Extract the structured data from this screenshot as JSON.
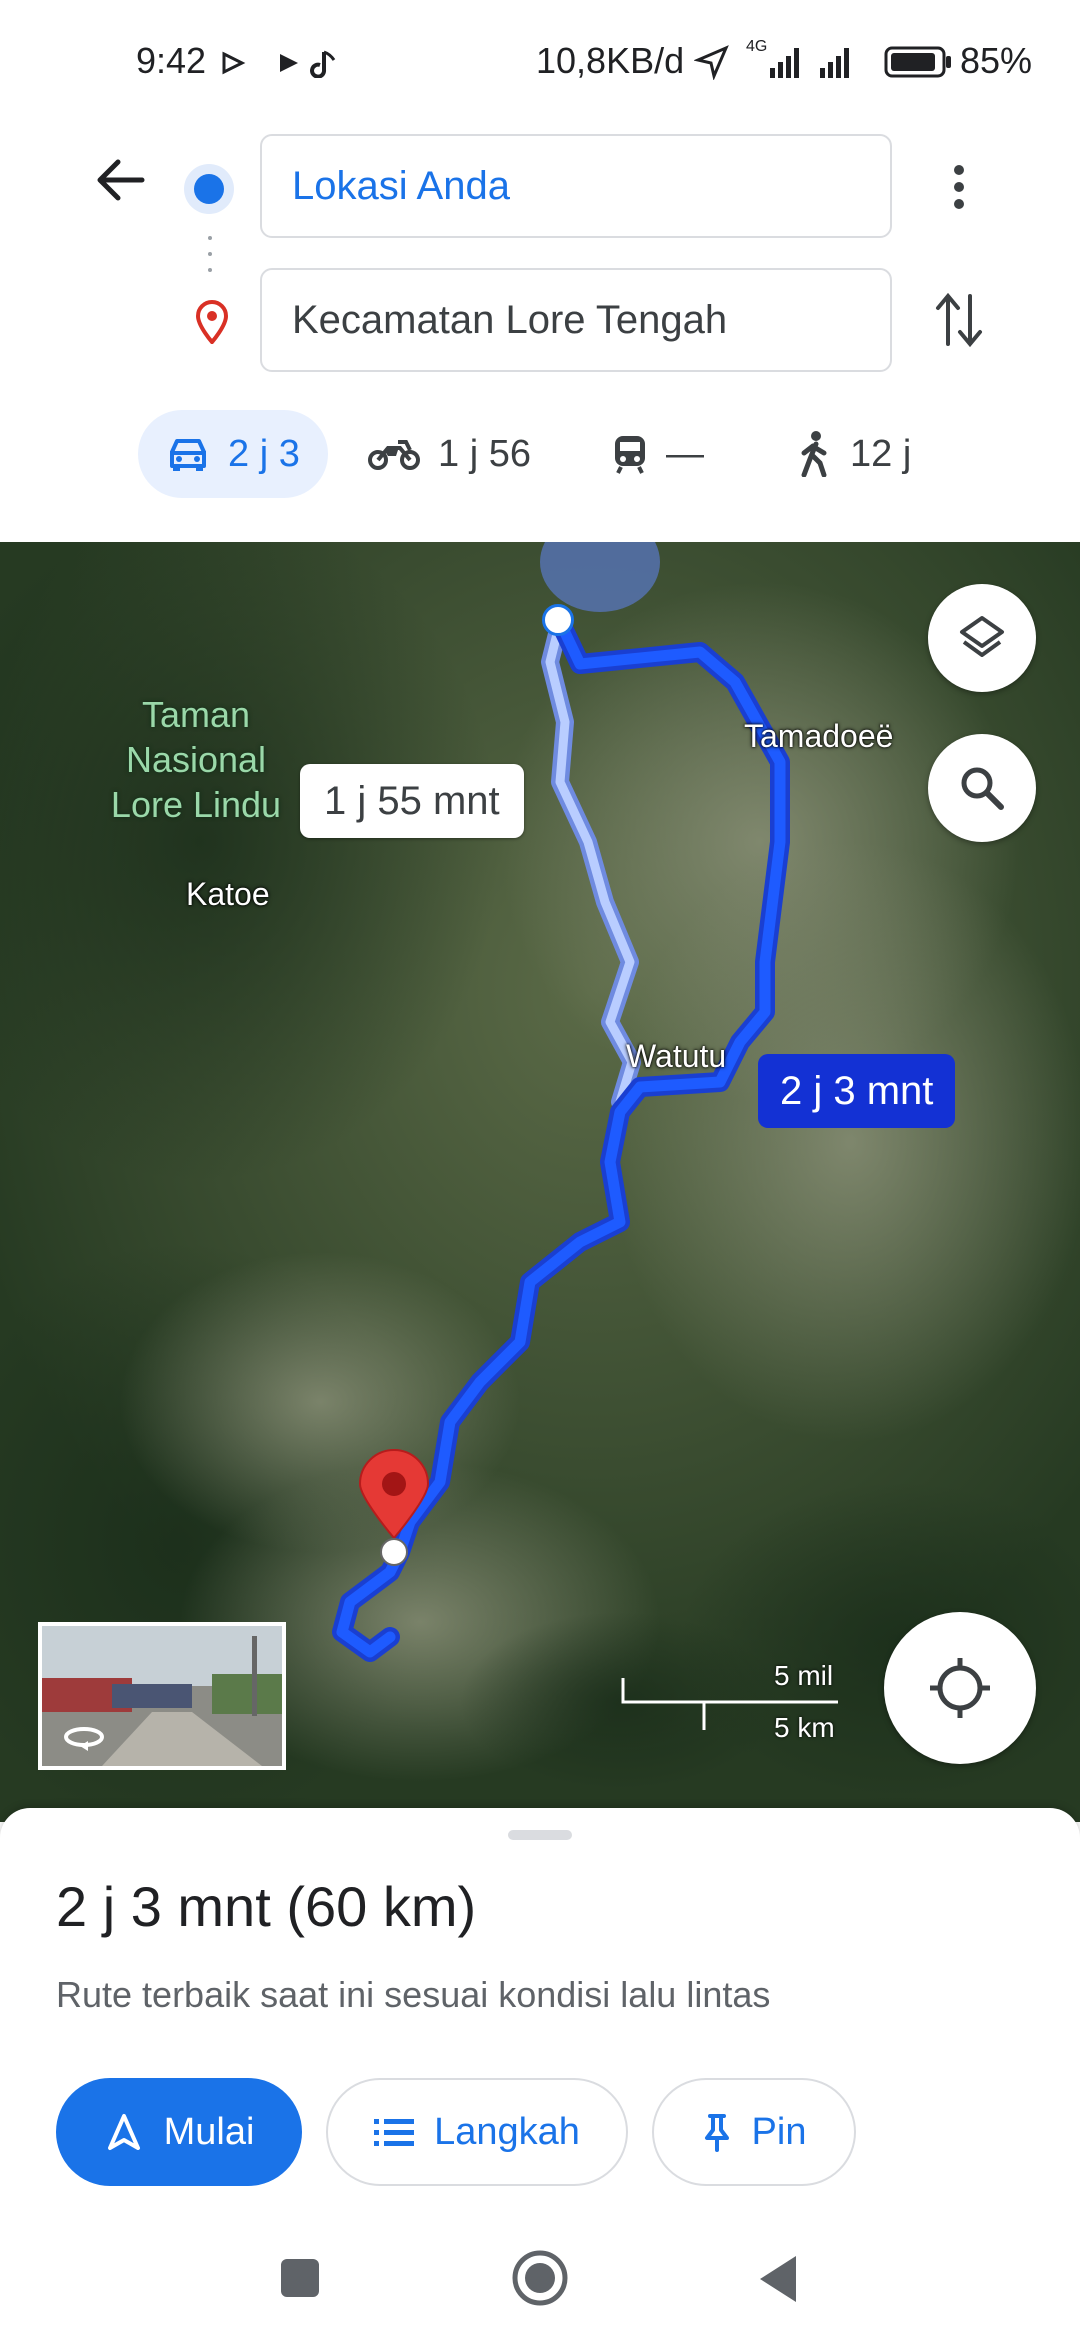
{
  "status_bar": {
    "time": "9:42",
    "network_speed": "10,8KB/d",
    "network_type": "4G",
    "battery": "85%"
  },
  "directions": {
    "origin": "Lokasi Anda",
    "destination": "Kecamatan Lore Tengah",
    "modes": [
      {
        "icon": "car-icon",
        "label": "2 j 3"
      },
      {
        "icon": "motorcycle-icon",
        "label": "1 j 56"
      },
      {
        "icon": "transit-icon",
        "label": "—"
      },
      {
        "icon": "walk-icon",
        "label": "12 j"
      }
    ]
  },
  "map": {
    "place_labels": {
      "park": "Taman Nasional Lore Lindu",
      "katoe": "Katoe",
      "watutu": "Watutu",
      "tamadoee": "Tamadoeë"
    },
    "alt_route_label": "1 j 55 mnt",
    "main_route_label": "2 j 3 mnt",
    "scale": {
      "miles": "5 mil",
      "km": "5 km"
    }
  },
  "sheet": {
    "summary": "2 j 3 mnt (60 km)",
    "subtitle": "Rute terbaik saat ini sesuai kondisi lalu lintas",
    "buttons": {
      "start": "Mulai",
      "steps": "Langkah",
      "pin": "Pin"
    }
  },
  "colors": {
    "accent": "#1a73e8",
    "route": "#0d47f2",
    "route_alt": "#a9c2ff",
    "destination_pin": "#e53935"
  }
}
